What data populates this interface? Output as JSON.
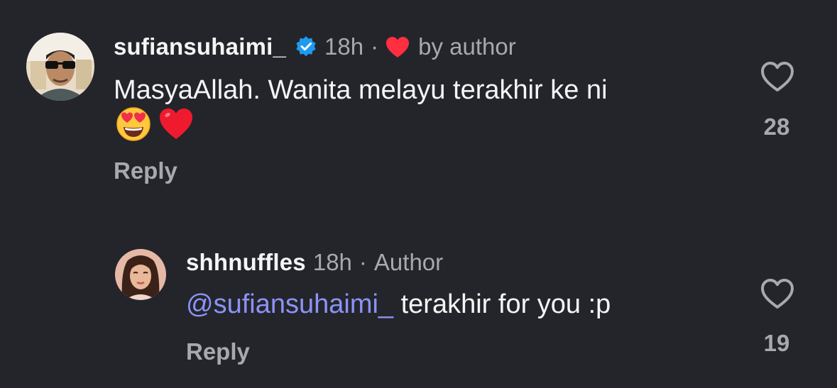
{
  "comments": [
    {
      "username": "sufiansuhaimi_",
      "verified": true,
      "time": "18h",
      "separator": "·",
      "author_like_label": "by author",
      "text": "MasyaAllah. Wanita melayu terakhir ke ni",
      "emojis": [
        "😍",
        "❤️"
      ],
      "reply_label": "Reply",
      "like_count": "28",
      "avatar_icon": "avatar-photo-man-sunglasses"
    },
    {
      "username": "shhnuffles",
      "time": "18h",
      "separator": "·",
      "author_label": "Author",
      "mention": "@sufiansuhaimi_",
      "text": " terakhir for you :p",
      "reply_label": "Reply",
      "like_count": "19",
      "avatar_icon": "avatar-photo-woman"
    }
  ],
  "colors": {
    "background": "#24252b",
    "primary_text": "#f5f5f5",
    "secondary_text": "#a8a8ad",
    "mention": "#8b93f6",
    "verified_blue": "#1d9bf0",
    "heart_red": "#ff2f40"
  }
}
